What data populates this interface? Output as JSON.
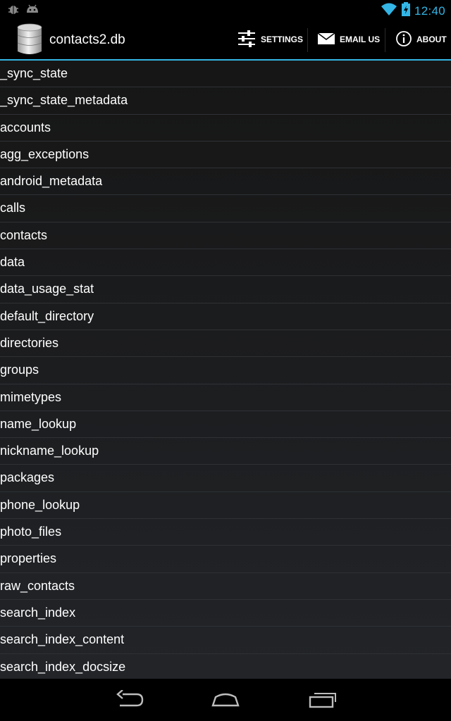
{
  "status_bar": {
    "clock": "12:40",
    "icons_left": [
      "bug-icon",
      "android-icon"
    ],
    "icons_right": [
      "wifi-icon",
      "battery-icon"
    ]
  },
  "action_bar": {
    "title": "contacts2.db",
    "settings_label": "SETTINGS",
    "email_label": "EMAIL US",
    "about_label": "ABOUT"
  },
  "tables": [
    "_sync_state",
    "_sync_state_metadata",
    "accounts",
    "agg_exceptions",
    "android_metadata",
    "calls",
    "contacts",
    "data",
    "data_usage_stat",
    "default_directory",
    "directories",
    "groups",
    "mimetypes",
    "name_lookup",
    "nickname_lookup",
    "packages",
    "phone_lookup",
    "photo_files",
    "properties",
    "raw_contacts",
    "search_index",
    "search_index_content",
    "search_index_docsize"
  ],
  "colors": {
    "accent": "#33b5e5",
    "background": "#000000",
    "list_divider": "#2e3135"
  }
}
